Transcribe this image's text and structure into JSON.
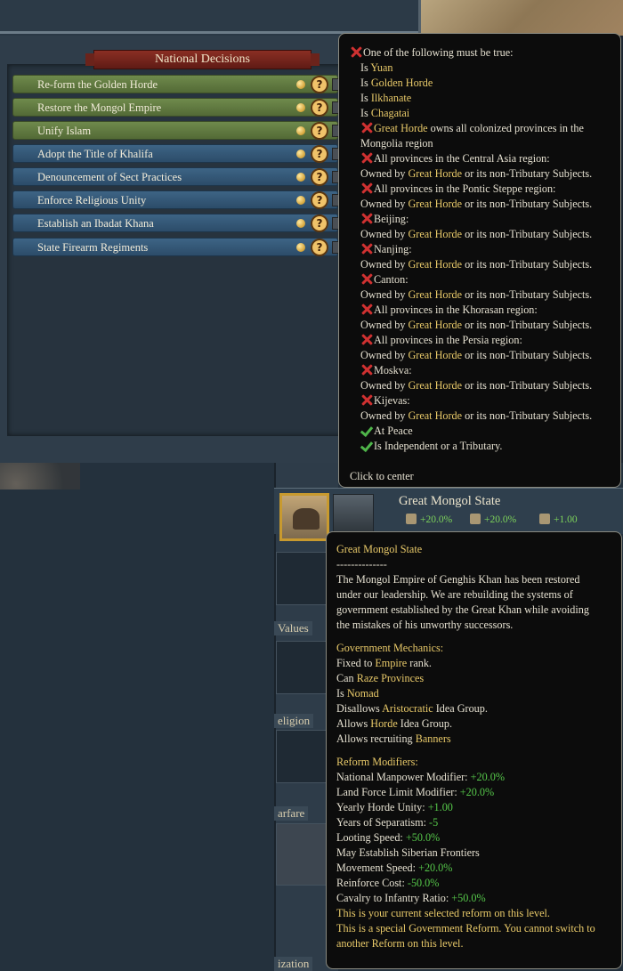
{
  "decisions": {
    "title": "National Decisions",
    "items": [
      {
        "label": "Re-form the Golden Horde",
        "style": "green"
      },
      {
        "label": "Restore the Mongol Empire",
        "style": "green"
      },
      {
        "label": "Unify Islam",
        "style": "green"
      },
      {
        "label": "Adopt the Title of Khalifa",
        "style": "blue"
      },
      {
        "label": "Denouncement of Sect Practices",
        "style": "blue"
      },
      {
        "label": "Enforce Religious Unity",
        "style": "blue"
      },
      {
        "label": "Establish an Ibadat Khana",
        "style": "blue"
      },
      {
        "label": "State Firearm Regiments",
        "style": "blue"
      }
    ],
    "help_glyph": "?"
  },
  "requirements_tooltip": {
    "one_of_title": "One of the following must be true:",
    "is_prefix": "Is",
    "tags": [
      "Yuan",
      "Golden Horde",
      "Ilkhanate",
      "Chagatai"
    ],
    "owner": "Great Horde",
    "colonized_text": "owns all colonized provinces in the",
    "mongolia_text": "Mongolia region",
    "owned_by_prefix": "Owned by",
    "owned_by_suffix": "or its non-Tributary Subjects.",
    "conditions": [
      "All provinces in the Central Asia region:",
      "All provinces in the Pontic Steppe region:",
      "Beijing:",
      "Nanjing:",
      "Canton:",
      "All provinces in the Khorasan region:",
      "All provinces in the Persia region:",
      "Moskva:",
      "Kijevas:"
    ],
    "met": [
      "At Peace",
      "Is Independent or a Tributary."
    ],
    "footer": "Click to center"
  },
  "side_labels": {
    "values": "Values",
    "religion": "eligion",
    "warfare": "arfare",
    "ization": "ization"
  },
  "reform_header": {
    "title": "Great Mongol State",
    "modifiers": [
      "+20.0%",
      "+20.0%",
      "+1.00"
    ]
  },
  "reform_tooltip": {
    "title": "Great Mongol State",
    "separator": "--------------",
    "description": [
      "The Mongol Empire of Genghis Khan has been restored",
      "under our leadership. We are rebuilding the systems of",
      "government established by the Great Khan while avoiding",
      "the mistakes of his unworthy successors."
    ],
    "mechanics_header": "Government Mechanics:",
    "mech_fixed_a": "Fixed to",
    "mech_fixed_hl": "Empire",
    "mech_fixed_b": "rank.",
    "mech_raze_a": "Can",
    "mech_raze_hl": "Raze Provinces",
    "mech_nomad_a": "Is",
    "mech_nomad_hl": "Nomad",
    "mech_disallow_a": "Disallows",
    "mech_disallow_hl": "Aristocratic",
    "mech_disallow_b": "Idea Group.",
    "mech_allow_a": "Allows",
    "mech_allow_hl": "Horde",
    "mech_allow_b": "Idea Group.",
    "mech_banner_a": "Allows recruiting",
    "mech_banner_hl": "Banners",
    "modifiers_header": "Reform Modifiers:",
    "modifiers": [
      {
        "label": "National Manpower Modifier:",
        "value": "+20.0%"
      },
      {
        "label": "Land Force Limit Modifier:",
        "value": "+20.0%"
      },
      {
        "label": "Yearly Horde Unity:",
        "value": "+1.00"
      },
      {
        "label": "Years of Separatism:",
        "value": "-5"
      },
      {
        "label": "Looting Speed:",
        "value": "+50.0%"
      },
      {
        "label": "May Establish Siberian Frontiers",
        "value": ""
      },
      {
        "label": "Movement Speed:",
        "value": "+20.0%"
      },
      {
        "label": "Reinforce Cost:",
        "value": "-50.0%"
      },
      {
        "label": "Cavalry to Infantry Ratio:",
        "value": "+50.0%"
      }
    ],
    "current_note": "This is your current selected reform on this level.",
    "special_note_1": "This is a special Government Reform. You cannot switch to",
    "special_note_2": "another Reform on this level."
  }
}
